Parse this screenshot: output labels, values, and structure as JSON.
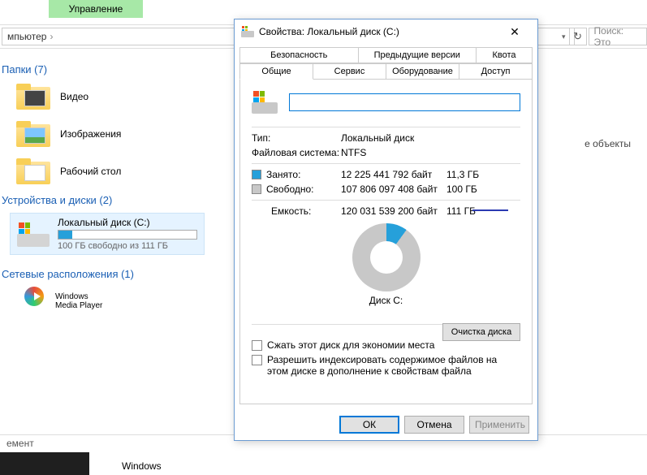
{
  "explorer": {
    "ribbon_tab": "Управление",
    "breadcrumb": "мпьютер",
    "search_placeholder": "Поиск: Это",
    "sections": {
      "folders": {
        "header": "Папки (7)",
        "items": [
          "Видео",
          "Изображения",
          "Рабочий стол"
        ]
      },
      "drives": {
        "header": "Устройства и диски (2)",
        "drive": {
          "name": "Локальный диск (C:)",
          "subtext": "100 ГБ свободно из 111 ГБ"
        }
      },
      "network": {
        "header": "Сетевые расположения (1)",
        "wmp": "Windows\nMedia Player"
      }
    },
    "right_hint": "е объекты",
    "status": "емент",
    "taskbar_item": "Windows"
  },
  "dialog": {
    "title": "Свойства: Локальный диск (C:)",
    "tabs_row1": [
      "Безопасность",
      "Предыдущие версии",
      "Квота"
    ],
    "tabs_row2": [
      "Общие",
      "Сервис",
      "Оборудование",
      "Доступ"
    ],
    "active_tab": "Общие",
    "drive_name_value": "",
    "type_label": "Тип:",
    "type_value": "Локальный диск",
    "fs_label": "Файловая система:",
    "fs_value": "NTFS",
    "used_label": "Занято:",
    "used_bytes": "12 225 441 792 байт",
    "used_gb": "11,3 ГБ",
    "free_label": "Свободно:",
    "free_bytes": "107 806 097 408 байт",
    "free_gb": "100 ГБ",
    "capacity_label": "Емкость:",
    "capacity_bytes": "120 031 539 200 байт",
    "capacity_gb": "111 ГБ",
    "chart_label": "Диск C:",
    "cleanup_btn": "Очистка диска",
    "compress_check": "Сжать этот диск для экономии места",
    "index_check": "Разрешить индексировать содержимое файлов на этом диске в дополнение к свойствам файла",
    "buttons": {
      "ok": "ОК",
      "cancel": "Отмена",
      "apply": "Применить"
    }
  },
  "chart_data": {
    "type": "pie",
    "title": "Диск C:",
    "categories": [
      "Занято",
      "Свободно"
    ],
    "values": [
      12225441792,
      107806097408
    ],
    "series": [
      {
        "name": "Занято",
        "bytes": 12225441792,
        "display": "11,3 ГБ",
        "color": "#26a0da"
      },
      {
        "name": "Свободно",
        "bytes": 107806097408,
        "display": "100 ГБ",
        "color": "#c8c8c8"
      }
    ],
    "total": {
      "bytes": 120031539200,
      "display": "111 ГБ"
    }
  }
}
